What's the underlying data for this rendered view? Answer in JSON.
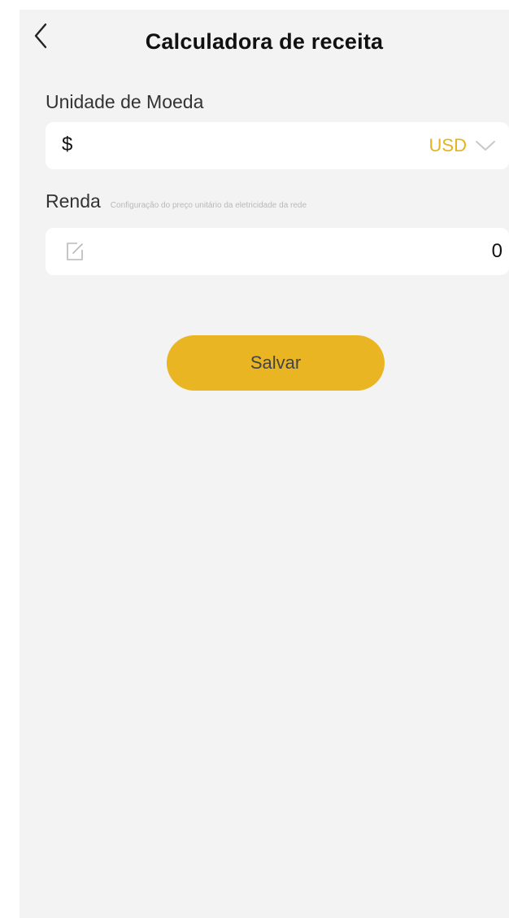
{
  "header": {
    "title": "Calculadora de receita",
    "back_icon": "chevron-left-icon"
  },
  "currency": {
    "label": "Unidade de Moeda",
    "symbol": "$",
    "selected_code": "USD",
    "dropdown_icon": "chevron-down-icon",
    "accent_color": "#e6b31e"
  },
  "income": {
    "label": "Renda",
    "hint": "Configuração do preço unitário da eletricidade da rede",
    "value": "0",
    "edit_icon": "edit-icon"
  },
  "actions": {
    "save_label": "Salvar",
    "button_color": "#e9b523"
  }
}
